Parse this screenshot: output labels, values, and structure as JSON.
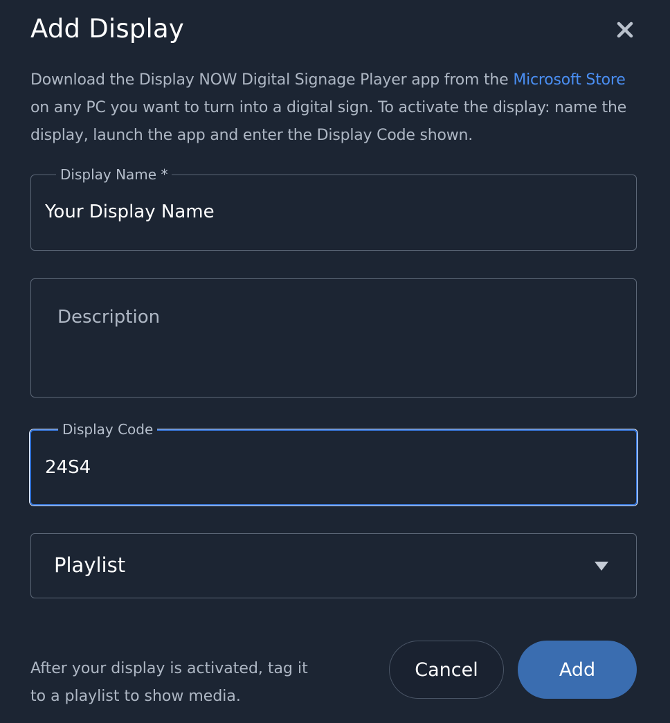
{
  "dialog": {
    "title": "Add Display",
    "intro_before_link": "Download the Display NOW Digital Signage Player app from the ",
    "intro_link": "Microsoft Store",
    "intro_after_link": " on any PC you want to turn into a digital sign. To activate the display: name the display, launch the app and enter the Display Code shown.",
    "close_icon": "close-icon"
  },
  "form": {
    "display_name": {
      "label": "Display Name *",
      "value": "Your Display Name"
    },
    "description": {
      "placeholder": "Description"
    },
    "display_code": {
      "label": "Display Code",
      "value": "24S4"
    },
    "playlist": {
      "selected": "Playlist"
    }
  },
  "footer": {
    "note": "After your display is activated, tag it to a playlist to show media.",
    "cancel_label": "Cancel",
    "add_label": "Add"
  },
  "colors": {
    "background": "#1c2533",
    "link": "#4a8ef2",
    "focus": "#3574d8",
    "primary_button": "#3a6db0"
  }
}
